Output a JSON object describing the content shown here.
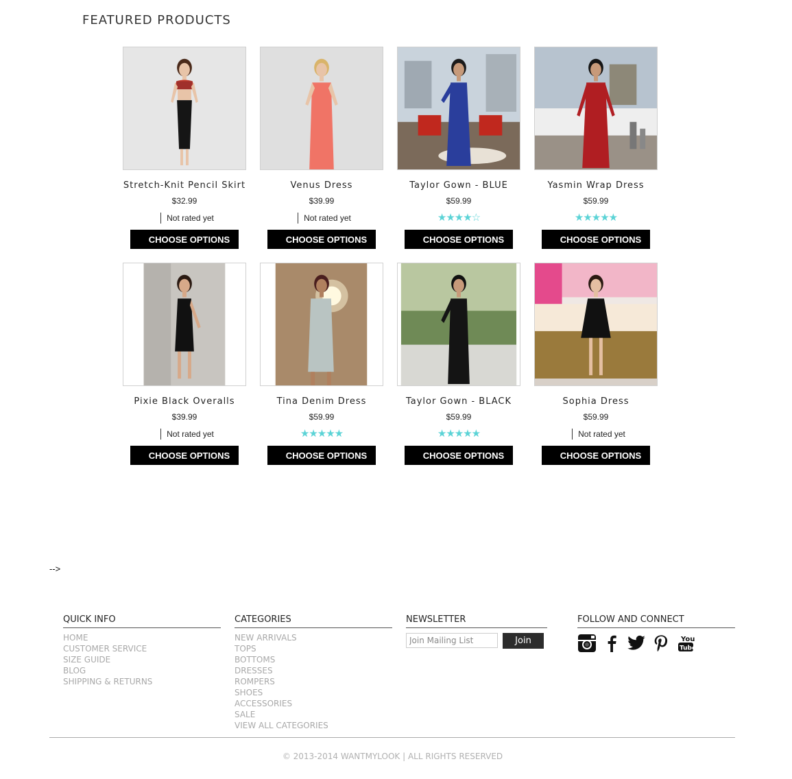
{
  "section_title": "FEATURED PRODUCTS",
  "button_label": "CHOOSE OPTIONS",
  "not_rated_label": "Not rated yet",
  "star_color": "#5bd3d6",
  "products": [
    {
      "name": "Stretch-Knit Pencil Skirt",
      "price": "$32.99",
      "rating": null
    },
    {
      "name": "Venus Dress",
      "price": "$39.99",
      "rating": null
    },
    {
      "name": "Taylor Gown - BLUE",
      "price": "$59.99",
      "rating": 4
    },
    {
      "name": "Yasmin Wrap Dress",
      "price": "$59.99",
      "rating": 5
    },
    {
      "name": "Pixie Black Overalls",
      "price": "$39.99",
      "rating": null
    },
    {
      "name": "Tina Denim Dress",
      "price": "$59.99",
      "rating": 5
    },
    {
      "name": "Taylor Gown - BLACK",
      "price": "$59.99",
      "rating": 5
    },
    {
      "name": "Sophia Dress",
      "price": "$59.99",
      "rating": null
    }
  ],
  "stray_text": "-->",
  "footer": {
    "quick_info": {
      "heading": "QUICK INFO",
      "links": [
        "HOME",
        "CUSTOMER SERVICE",
        "SIZE GUIDE",
        "BLOG",
        "SHIPPING & RETURNS"
      ]
    },
    "categories": {
      "heading": "CATEGORIES",
      "links": [
        "NEW ARRIVALS",
        "TOPS",
        "BOTTOMS",
        "DRESSES",
        "ROMPERS",
        "SHOES",
        "ACCESSORIES",
        "SALE",
        "VIEW ALL CATEGORIES"
      ]
    },
    "newsletter": {
      "heading": "NEWSLETTER",
      "placeholder": "Join Mailing List",
      "join_label": "Join"
    },
    "follow": {
      "heading": "FOLLOW AND CONNECT",
      "icons": [
        "instagram-icon",
        "facebook-icon",
        "twitter-icon",
        "pinterest-icon",
        "youtube-icon"
      ]
    },
    "copyright": "© 2013-2014 WANTMYLOOK | ALL RIGHTS RESERVED"
  }
}
